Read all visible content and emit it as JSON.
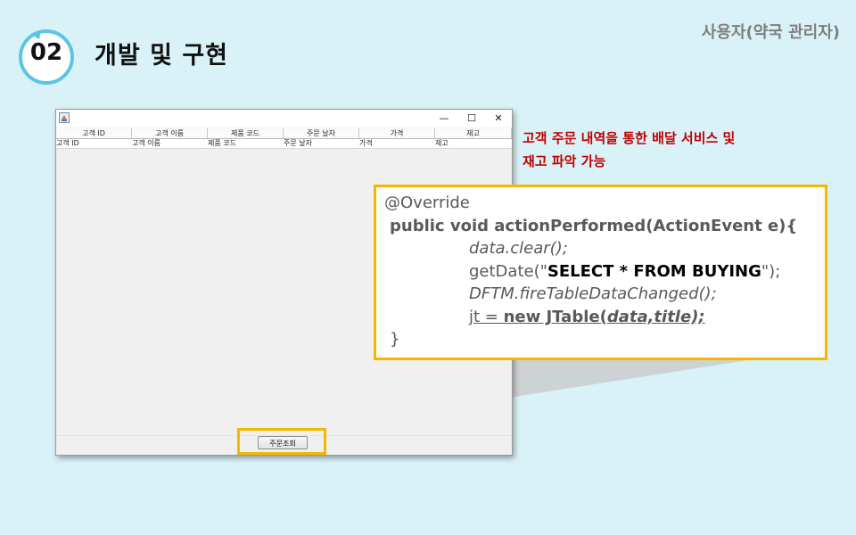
{
  "header": {
    "section_number": "02",
    "section_title": "개발 및 구현",
    "role_label": "사용자(약국 관리자)"
  },
  "window": {
    "controls": {
      "minimize": "—",
      "maximize": "☐",
      "close": "✕"
    },
    "table": {
      "columns": [
        "고객 ID",
        "고객 이름",
        "제품 코드",
        "주문 날자",
        "가격",
        "재고"
      ],
      "rows": [
        [
          "고객 ID",
          "고객 이름",
          "제품 코드",
          "주문 날자",
          "가격",
          "재고"
        ]
      ]
    },
    "order_button_label": "주문조회"
  },
  "description": {
    "line1": "고객 주문 내역을 통한 배달 서비스 및",
    "line2": "재고 파악 가능"
  },
  "code": {
    "annotation": "@Override",
    "signature": "public void actionPerformed(ActionEvent  e){",
    "line_clear": "data.clear();",
    "getdate_prefix": "getDate(\"",
    "getdate_sql": "SELECT  * FROM BUYING",
    "getdate_suffix": "\");",
    "line_fire": "DFTM.fireTableDataChanged();",
    "jt_prefix": "jt = ",
    "jt_new": "new JTable(",
    "jt_args": "data,title);",
    "closing": "}"
  },
  "colors": {
    "background": "#d9f2f8",
    "accent_yellow": "#f5b800",
    "badge_blue": "#5cc4e6",
    "description_red": "#c00000"
  }
}
